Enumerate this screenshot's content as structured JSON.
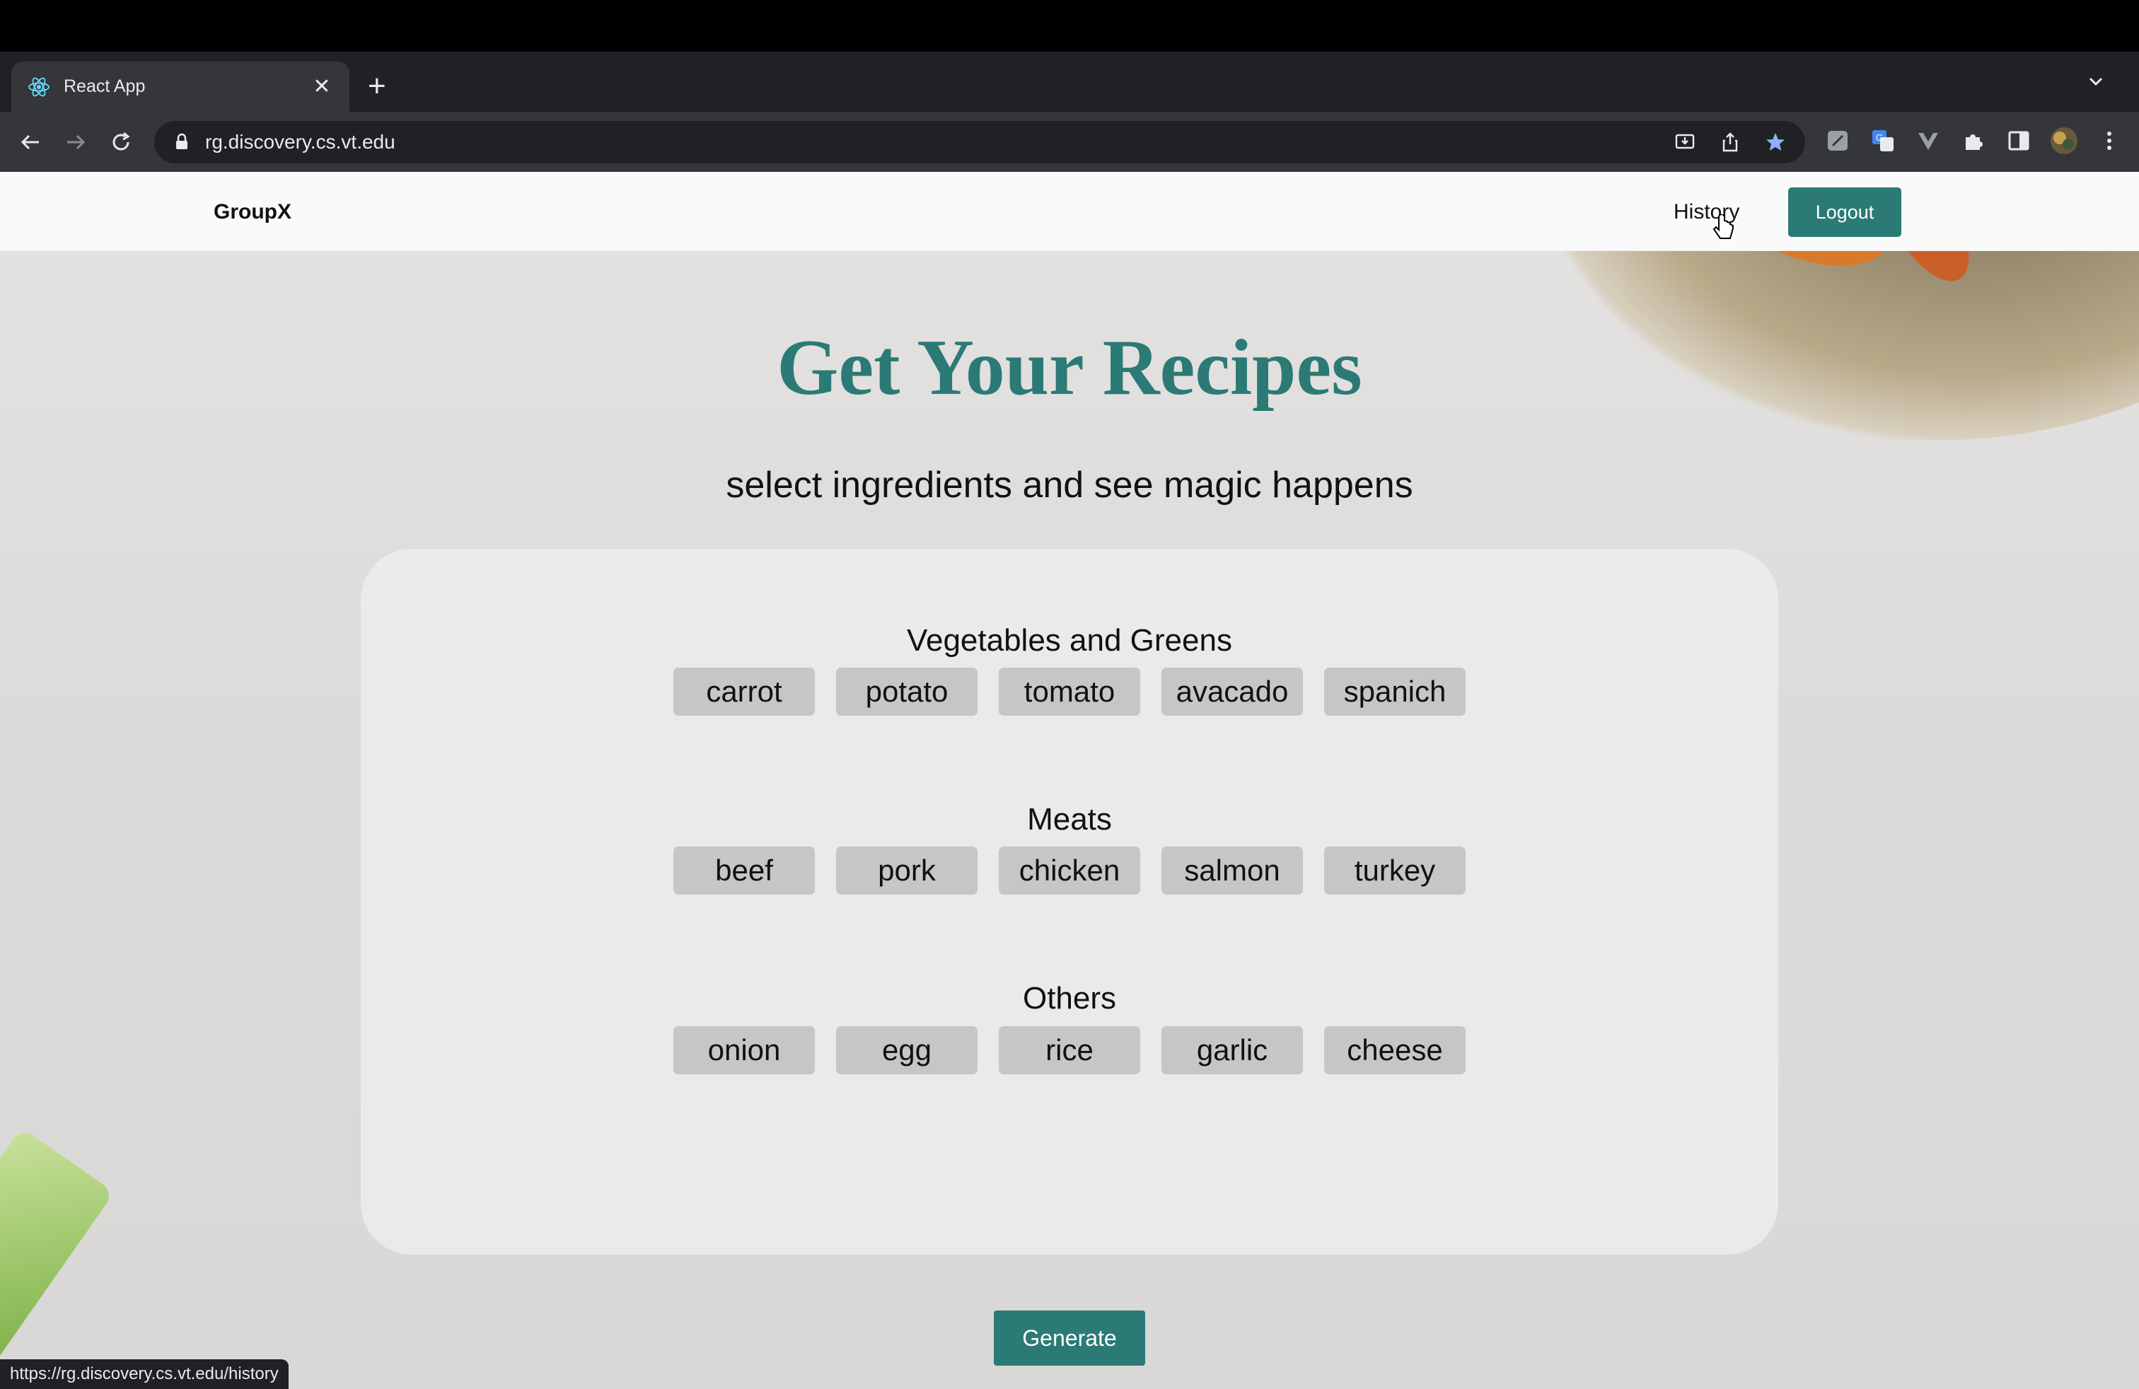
{
  "browser": {
    "tab_title": "React App",
    "tab_close": "✕",
    "new_tab": "+",
    "url": "rg.discovery.cs.vt.edu",
    "status_url": "https://rg.discovery.cs.vt.edu/history"
  },
  "navbar": {
    "brand": "GroupX",
    "history_label": "History",
    "logout_label": "Logout"
  },
  "hero": {
    "title": "Get Your Recipes",
    "subtitle": "select ingredients and see magic happens"
  },
  "sections": [
    {
      "title": "Vegetables and Greens",
      "items": [
        "carrot",
        "potato",
        "tomato",
        "avacado",
        "spanich"
      ]
    },
    {
      "title": "Meats",
      "items": [
        "beef",
        "pork",
        "chicken",
        "salmon",
        "turkey"
      ]
    },
    {
      "title": "Others",
      "items": [
        "onion",
        "egg",
        "rice",
        "garlic",
        "cheese"
      ]
    }
  ],
  "generate_label": "Generate",
  "colors": {
    "accent": "#2b7a75",
    "chip": "#c6c6c6"
  }
}
